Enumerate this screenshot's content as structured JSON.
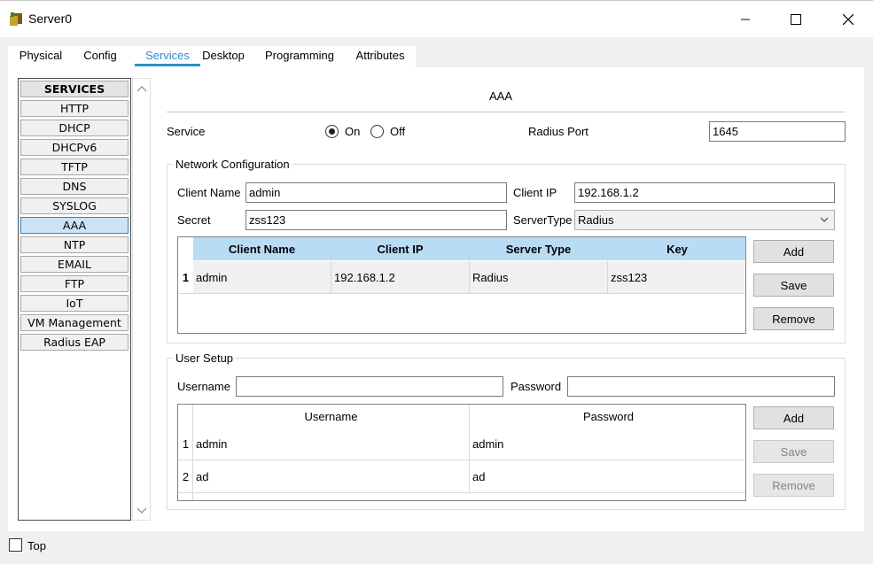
{
  "window": {
    "title": "Server0"
  },
  "tabs": [
    "Physical",
    "Config",
    "Services",
    "Desktop",
    "Programming",
    "Attributes"
  ],
  "services": {
    "header": "SERVICES",
    "items": [
      "HTTP",
      "DHCP",
      "DHCPv6",
      "TFTP",
      "DNS",
      "SYSLOG",
      "AAA",
      "NTP",
      "EMAIL",
      "FTP",
      "IoT",
      "VM Management",
      "Radius EAP"
    ],
    "selected": "AAA"
  },
  "aaa": {
    "title": "AAA",
    "service_label": "Service",
    "on_label": "On",
    "off_label": "Off",
    "service_state": "On",
    "radius_port_label": "Radius Port",
    "radius_port": "1645"
  },
  "network": {
    "title": "Network Configuration",
    "client_name_label": "Client Name",
    "client_name": "admin",
    "client_ip_label": "Client IP",
    "client_ip": "192.168.1.2",
    "secret_label": "Secret",
    "secret": "zss123",
    "server_type_label": "ServerType",
    "server_type": "Radius",
    "columns": [
      "Client Name",
      "Client IP",
      "Server Type",
      "Key"
    ],
    "rows": [
      {
        "num": "1",
        "client_name": "admin",
        "client_ip": "192.168.1.2",
        "server_type": "Radius",
        "key": "zss123"
      }
    ],
    "add_label": "Add",
    "save_label": "Save",
    "remove_label": "Remove"
  },
  "users": {
    "title": "User Setup",
    "username_label": "Username",
    "username": "",
    "password_label": "Password",
    "password": "",
    "columns": [
      "Username",
      "Password"
    ],
    "rows": [
      {
        "num": "1",
        "username": "admin",
        "password": "admin"
      },
      {
        "num": "2",
        "username": "ad",
        "password": "ad"
      }
    ],
    "add_label": "Add",
    "save_label": "Save",
    "remove_label": "Remove"
  },
  "footer": {
    "top_label": "Top",
    "top_checked": false
  }
}
